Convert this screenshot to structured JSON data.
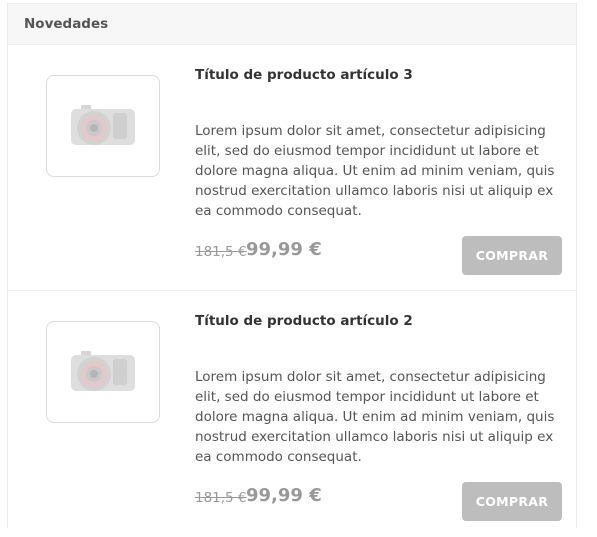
{
  "panel": {
    "heading": "Novedades"
  },
  "products": [
    {
      "title": "Título de producto artículo 3",
      "description": "Lorem ipsum dolor sit amet, consectetur adipisicing elit, sed do eiusmod tempor incididunt ut labore et dolore magna aliqua. Ut enim ad minim veniam, quis nostrud exercitation ullamco laboris nisi ut aliquip ex ea commodo consequat.",
      "old_price": "181,5 €",
      "price": "99,99 €",
      "buy_label": "COMPRAR",
      "image_icon": "camera-icon"
    },
    {
      "title": "Título de producto artículo 2",
      "description": "Lorem ipsum dolor sit amet, consectetur adipisicing elit, sed do eiusmod tempor incididunt ut labore et dolore magna aliqua. Ut enim ad minim veniam, quis nostrud exercitation ullamco laboris nisi ut aliquip ex ea commodo consequat.",
      "old_price": "181,5 €",
      "price": "99,99 €",
      "buy_label": "COMPRAR",
      "image_icon": "camera-icon"
    }
  ],
  "colors": {
    "button_bg": "#bdbdbd",
    "price": "#999999",
    "header_bg": "#f7f7f7"
  }
}
